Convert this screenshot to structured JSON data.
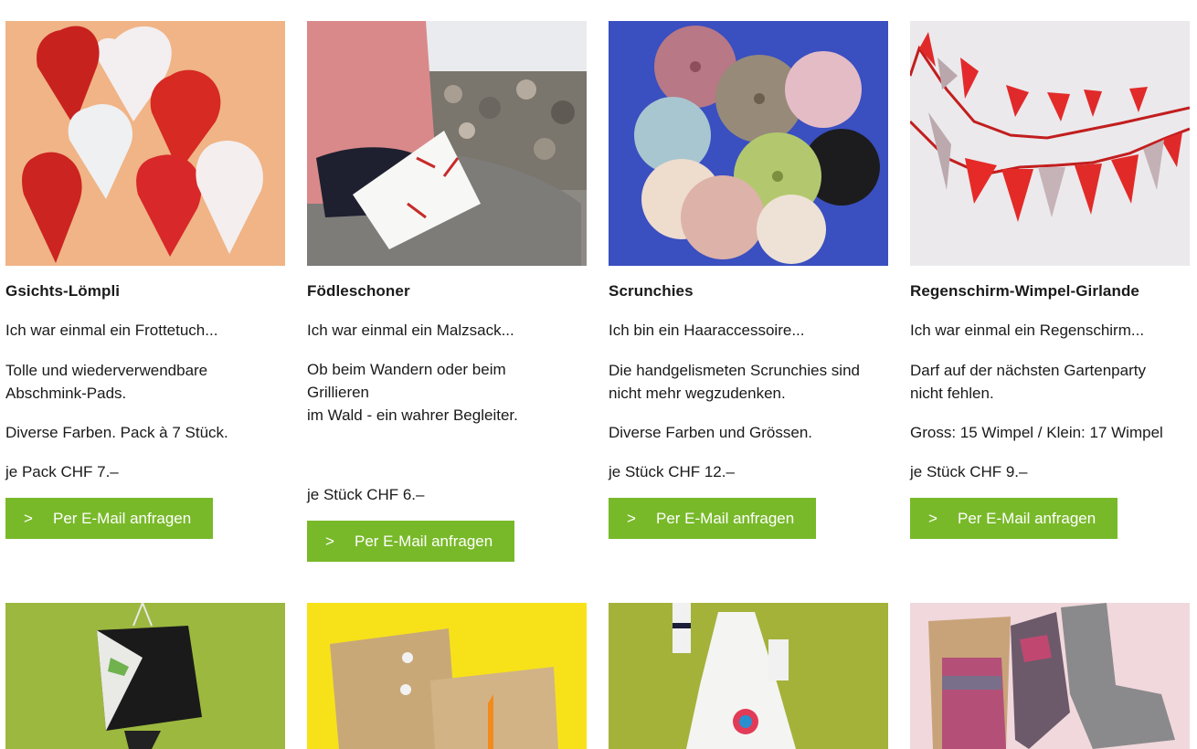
{
  "products": [
    {
      "title": "Gsichts-Lömpli",
      "tagline": "Ich war einmal ein Frottetuch...",
      "description": "Tolle und wiederverwendbare\nAbschmink-Pads.",
      "extra": "Diverse Farben. Pack à 7 Stück.",
      "price": "je Pack CHF 7.–",
      "button_label": "Per E-Mail anfragen"
    },
    {
      "title": "Födleschoner",
      "tagline": "Ich war einmal ein Malzsack...",
      "description": "Ob beim Wandern oder beim\nGrillieren\nim Wald - ein wahrer Begleiter.",
      "extra": "",
      "price": "je Stück CHF 6.–",
      "button_label": "Per E-Mail anfragen"
    },
    {
      "title": "Scrunchies",
      "tagline": "Ich bin ein Haaraccessoire...",
      "description": "Die handgelismeten Scrunchies sind\nnicht mehr wegzudenken.",
      "extra": "Diverse Farben und Grössen.",
      "price": "je Stück CHF 12.–",
      "button_label": "Per E-Mail anfragen"
    },
    {
      "title": "Regenschirm-Wimpel-Girlande",
      "tagline": "Ich war einmal ein Regenschirm...",
      "description": "Darf auf der nächsten Gartenparty\nnicht fehlen.",
      "extra": "Gross: 15 Wimpel / Klein: 17 Wimpel",
      "price": "je Stück CHF 9.–",
      "button_label": "Per E-Mail anfragen"
    }
  ],
  "button_icon": "chevron-right-icon",
  "button_glyph": ">",
  "colors": {
    "accent": "#78b929",
    "text": "#1a1a1a",
    "background": "#ffffff"
  }
}
